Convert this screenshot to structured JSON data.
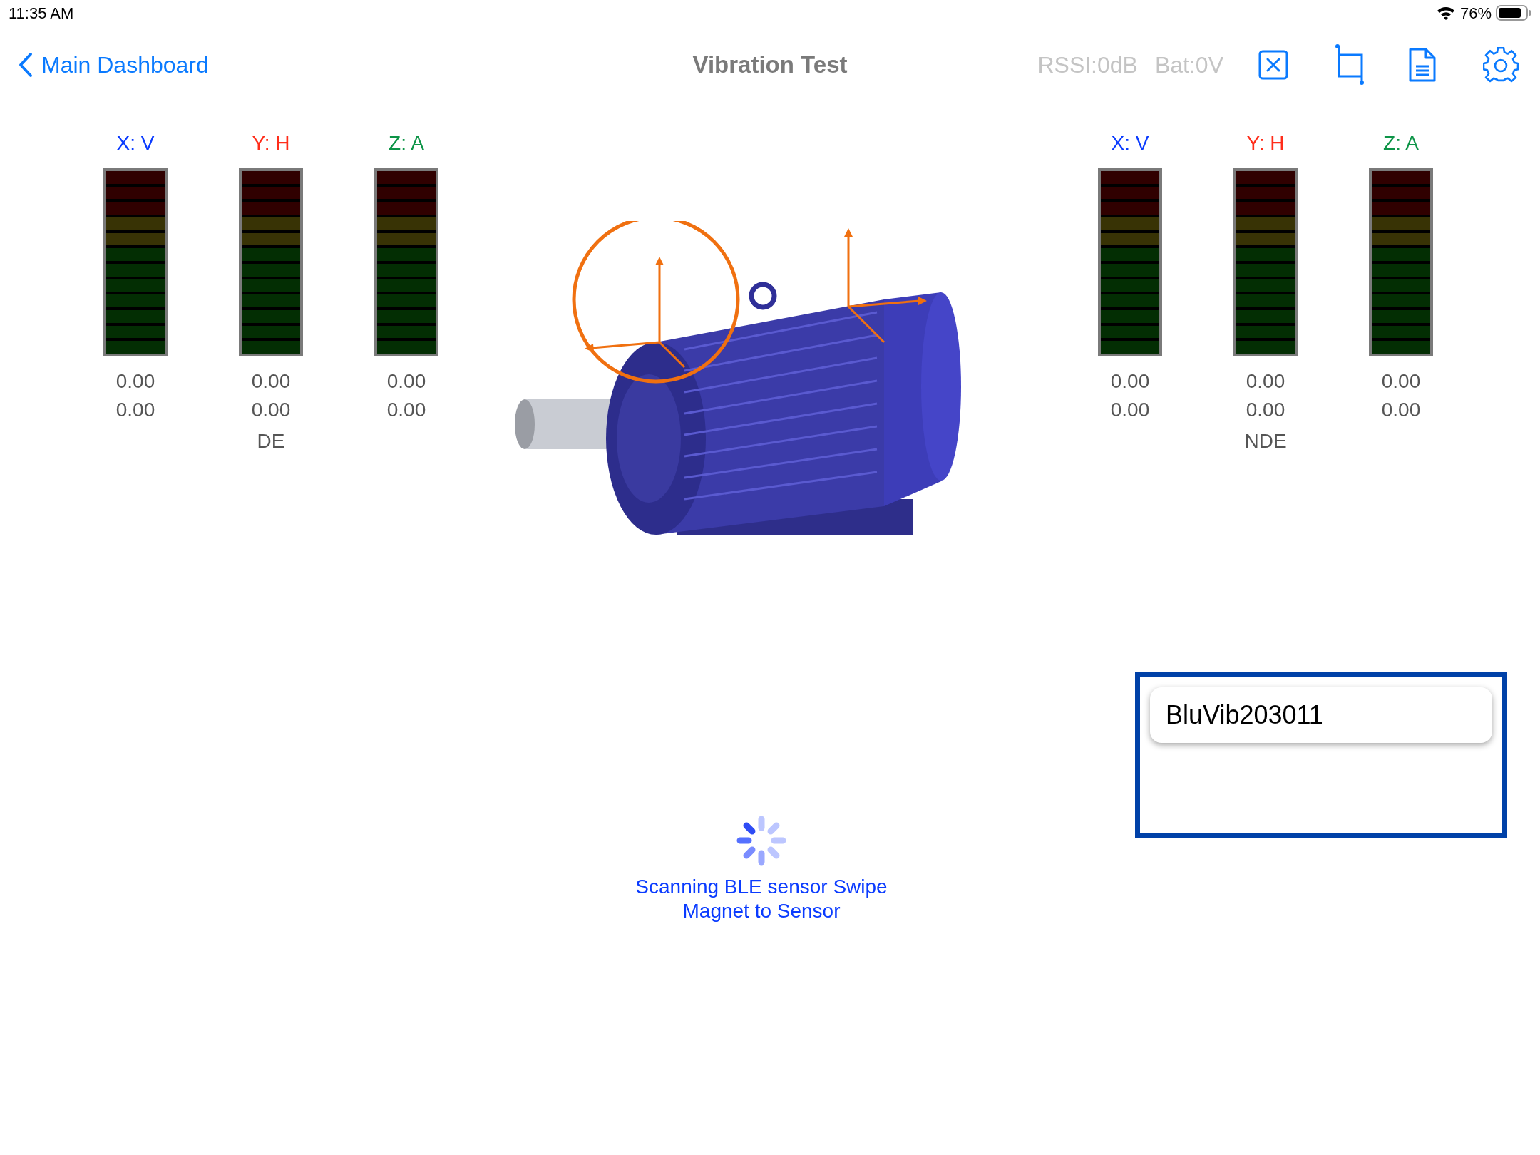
{
  "status_bar": {
    "time": "11:35 AM",
    "battery": "76%"
  },
  "nav": {
    "back": "Main Dashboard",
    "title": "Vibration Test",
    "rssi": "RSSI:0dB",
    "battery": "Bat:0V"
  },
  "sensor_groups": [
    {
      "label": "DE",
      "meters": [
        {
          "axis": "X: V",
          "color": "#0a3bff",
          "level": 0,
          "value_1": "0.00",
          "value_2": "0.00"
        },
        {
          "axis": "Y: H",
          "color": "#ff2d1a",
          "level": 0,
          "value_1": "0.00",
          "value_2": "0.00"
        },
        {
          "axis": "Z: A",
          "color": "#0d9447",
          "level": 0,
          "value_1": "0.00",
          "value_2": "0.00"
        }
      ]
    },
    {
      "label": "NDE",
      "meters": [
        {
          "axis": "X: V",
          "color": "#0a3bff",
          "level": 0,
          "value_1": "0.00",
          "value_2": "0.00"
        },
        {
          "axis": "Y: H",
          "color": "#ff2d1a",
          "level": 0,
          "value_1": "0.00",
          "value_2": "0.00"
        },
        {
          "axis": "Z: A",
          "color": "#0d9447",
          "level": 0,
          "value_1": "0.00",
          "value_2": "0.00"
        }
      ]
    }
  ],
  "device_list": {
    "devices": [
      "BluVib203011"
    ]
  },
  "scanning": {
    "message": "Scanning BLE sensor Swipe Magnet to Sensor"
  }
}
